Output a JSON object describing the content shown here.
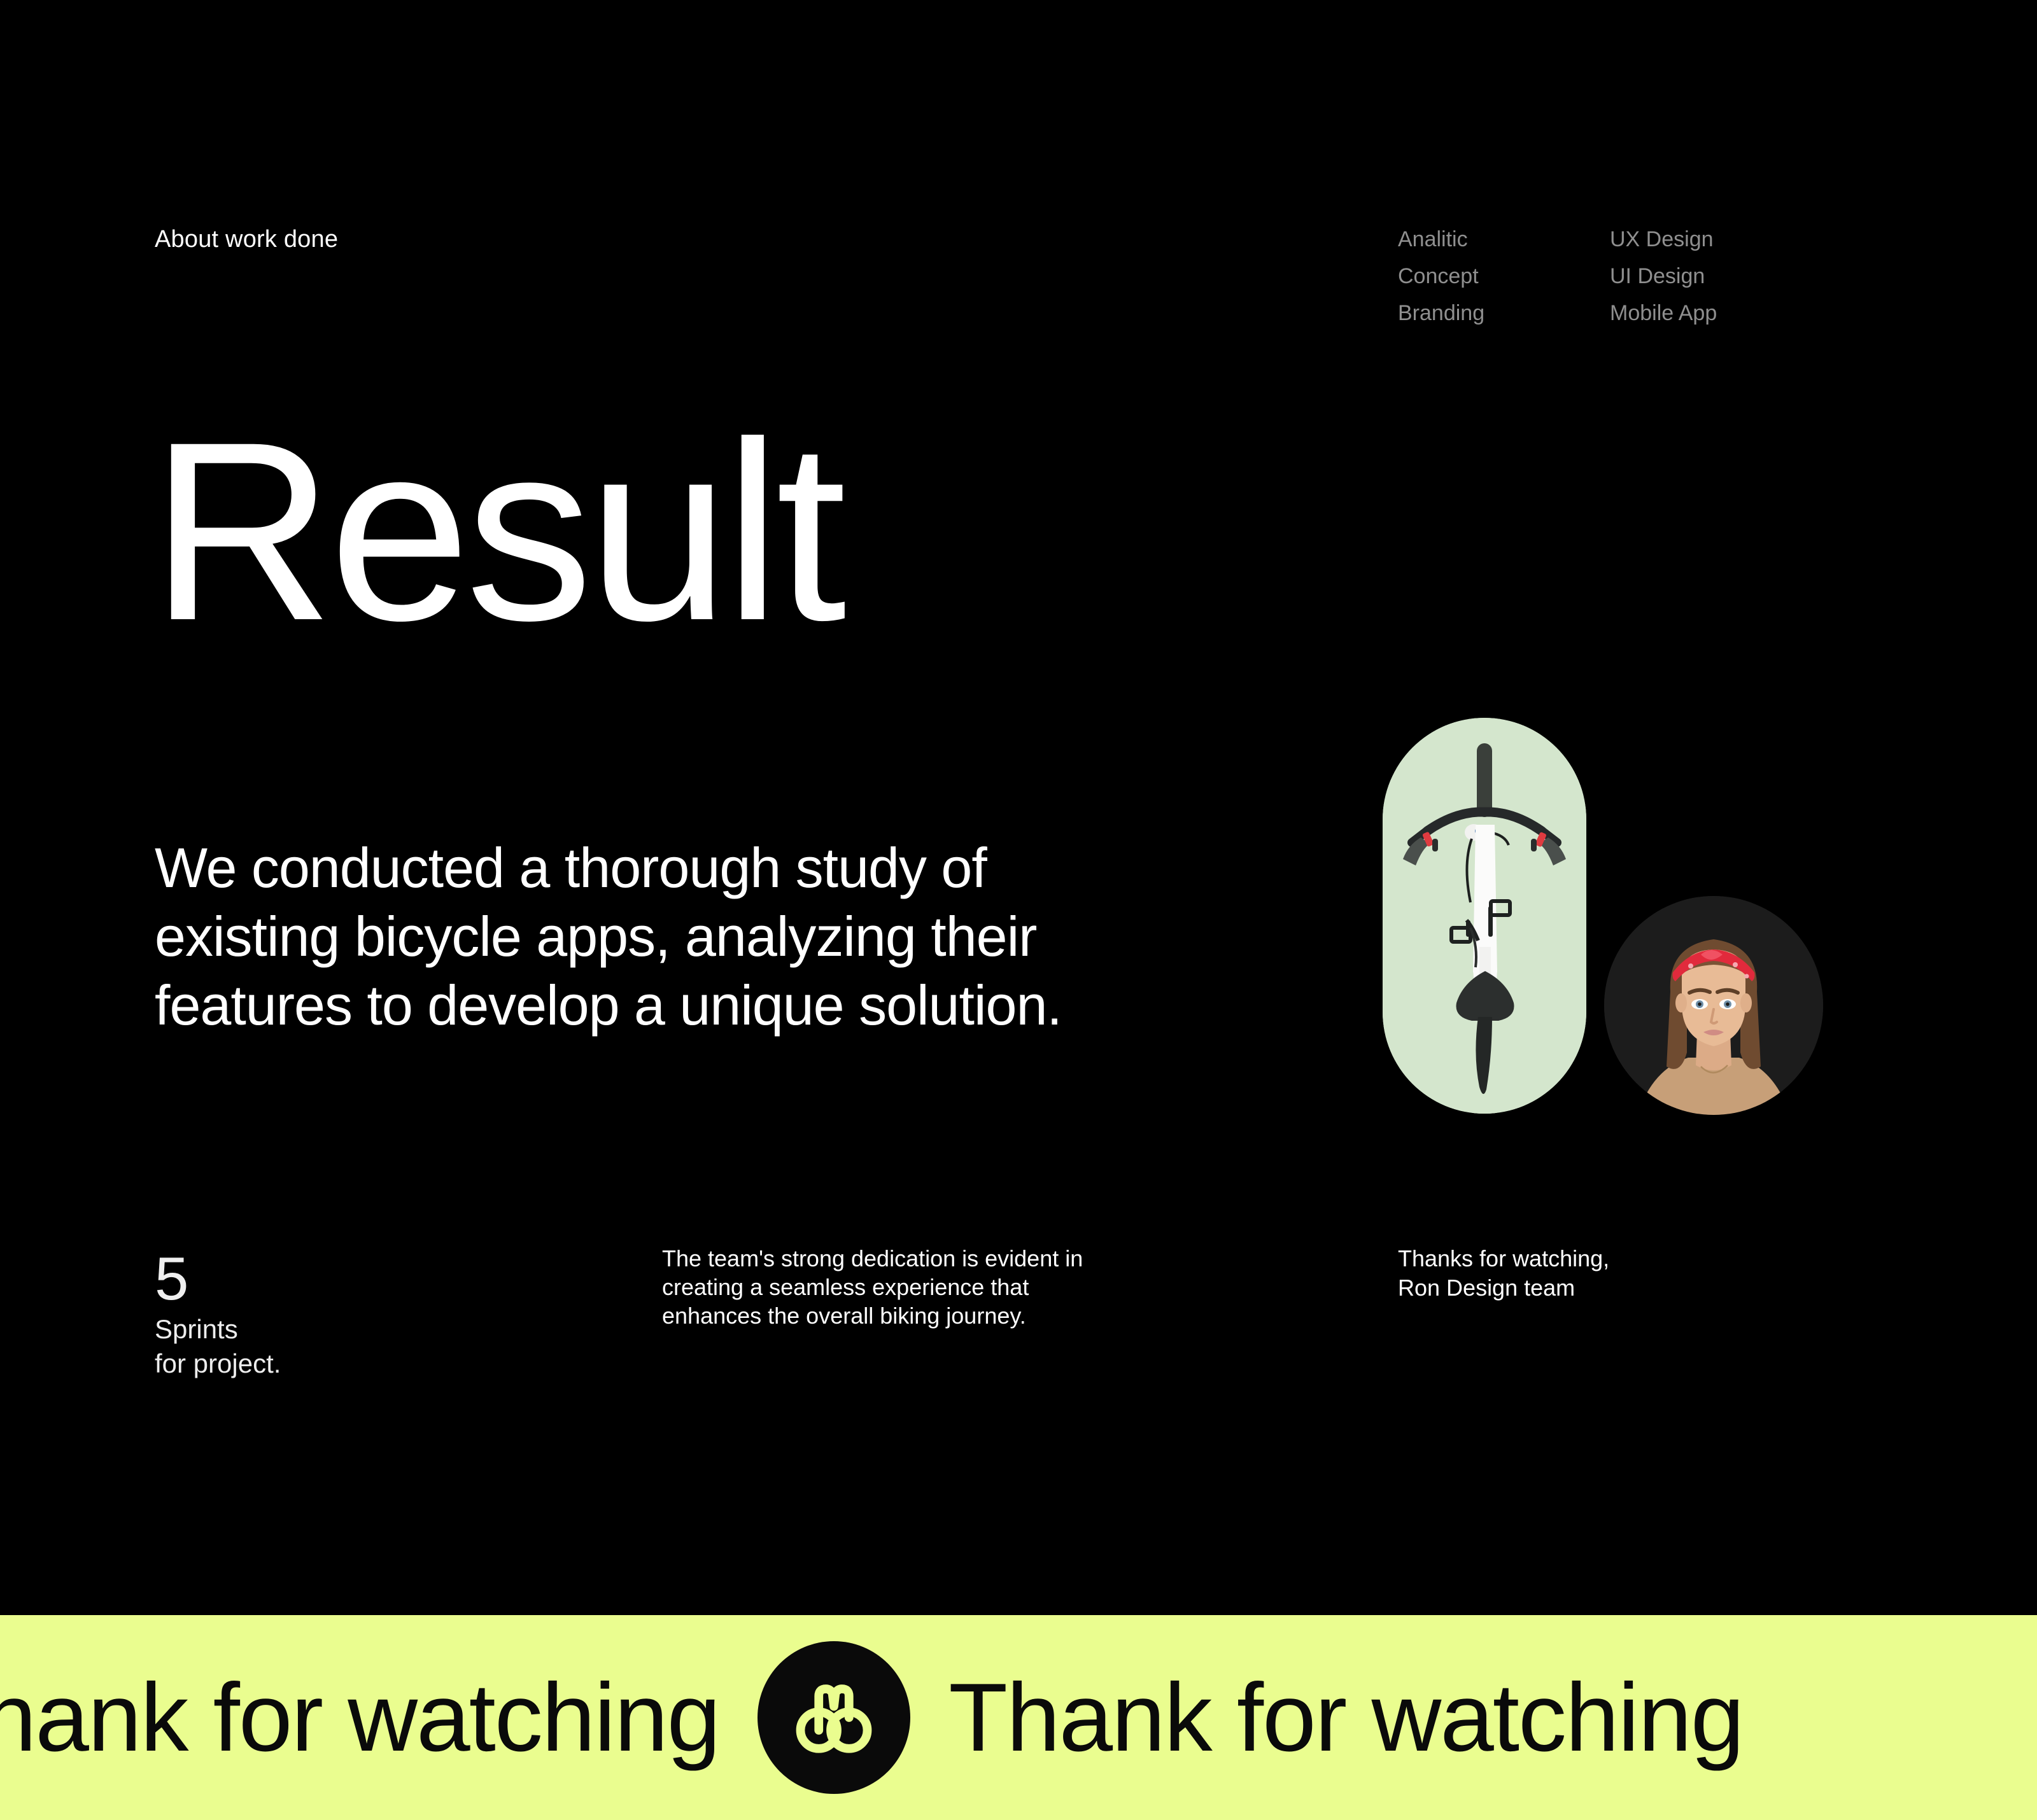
{
  "theme": {
    "background": "#000000",
    "text": "#ffffff",
    "muted_text": "#8f8f8f",
    "banner_background": "#eafd8f",
    "banner_text": "#0a0a0a",
    "pill_background": "#d4e6cd",
    "avatar_background": "#1c1c1c"
  },
  "header": {
    "eyebrow": "About work done",
    "tag_columns": [
      {
        "items": [
          "Analitic",
          "Concept",
          "Branding"
        ]
      },
      {
        "items": [
          "UX Design",
          "UI Design",
          "Mobile App"
        ]
      }
    ]
  },
  "hero": {
    "headline": "Result",
    "lead_paragraph": "We conducted a thorough study of existing bicycle apps, analyzing their features to develop a unique solution."
  },
  "stat": {
    "number": "5",
    "label_line_1": "Sprints",
    "label_line_2": "for project."
  },
  "note": {
    "line_1": "The team's strong dedication is evident in",
    "line_2": "creating a seamless experience that",
    "line_3": "enhances the overall biking journey."
  },
  "signoff": {
    "line_1": "Thanks for watching,",
    "line_2": "Ron Design team"
  },
  "media": {
    "bike_card_alt": "bicycle-top-view-photo",
    "avatar_alt": "team-member-portrait-photo"
  },
  "banner": {
    "marquee_text_left": "Thank for watching",
    "marquee_text_right": "Thank for watching",
    "logo_alt": "ron-design-bicycle-logo"
  }
}
